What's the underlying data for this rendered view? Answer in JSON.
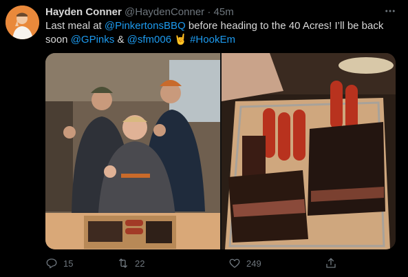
{
  "tweet": {
    "author_name": "Hayden Conner",
    "author_handle": "@HaydenConner",
    "separator": "·",
    "time": "45m",
    "text": {
      "part1": "Last meal at ",
      "mention1": "@PinkertonsBBQ",
      "part2": " before heading to the 40 Acres! I’ll be back soon ",
      "mention2": "@GPinks",
      "part3": " & ",
      "mention3": "@sfm006",
      "emoji": "🤘",
      "hashtag": "#HookEm"
    },
    "stats": {
      "replies": "15",
      "retweets": "22",
      "likes": "249"
    }
  },
  "icons": {
    "more": "more-horizontal-icon",
    "reply": "reply-icon",
    "retweet": "retweet-icon",
    "like": "heart-icon",
    "share": "share-icon"
  },
  "colors": {
    "background": "#000000",
    "text": "#d9d9d9",
    "muted": "#6e767d",
    "link": "#1d9bf0"
  }
}
